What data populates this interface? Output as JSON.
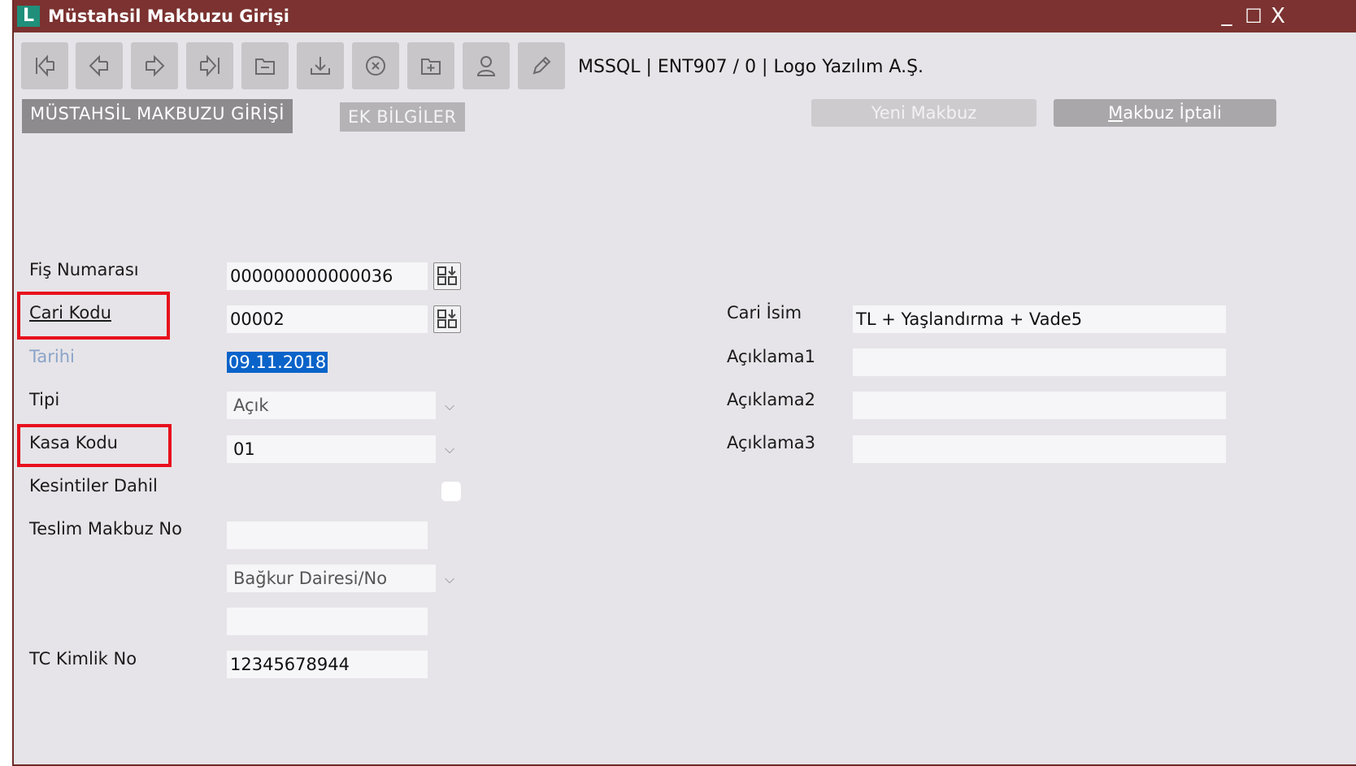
{
  "window": {
    "logo": "L",
    "title": "Müstahsil Makbuzu Girişi",
    "minimize": "_",
    "maximize": "☐",
    "close": "X"
  },
  "toolbar": {
    "buttons": [
      "first-record-icon",
      "previous-record-icon",
      "next-record-icon",
      "last-record-icon",
      "folder-icon",
      "download-icon",
      "cancel-icon",
      "add-document-icon",
      "user-icon",
      "edit-pencil-icon"
    ],
    "connection": "MSSQL | ENT907 / 0 | Logo Yazılım A.Ş."
  },
  "tabs": {
    "main": "MÜSTAHSİL MAKBUZU GİRİŞİ",
    "extra": "EK BİLGİLER"
  },
  "actions": {
    "new_receipt": "Yeni Makbuz",
    "cancel_receipt_prefix": "M",
    "cancel_receipt_rest": "akbuz İptali"
  },
  "form": {
    "fis_no_label": "Fiş Numarası",
    "fis_no_value": "000000000000036",
    "cari_kodu_label": "Cari Kodu",
    "cari_kodu_value": "00002",
    "tarih_label": "Tarihi",
    "tarih_value": "09.11.2018",
    "tipi_label": "Tipi",
    "tipi_value": "Açık",
    "kasa_kodu_label": "Kasa Kodu",
    "kasa_kodu_value": "01",
    "kesintiler_label": "Kesintiler Dahil",
    "teslim_label": "Teslim Makbuz No",
    "teslim_value": "",
    "bagkur_value": "Bağkur Dairesi/No",
    "bagkur_no_value": "",
    "tc_label": "TC Kimlik No",
    "tc_value": "12345678944",
    "cari_isim_label": "Cari İsim",
    "cari_isim_value": "TL + Yaşlandırma + Vade5",
    "aciklama1_label": "Açıklama1",
    "aciklama1_value": "",
    "aciklama2_label": "Açıklama2",
    "aciklama2_value": "",
    "aciklama3_label": "Açıklama3",
    "aciklama3_value": ""
  },
  "colors": {
    "titlebar": "#7b3230",
    "highlight": "#e8101c",
    "selection": "#0a63c9"
  }
}
